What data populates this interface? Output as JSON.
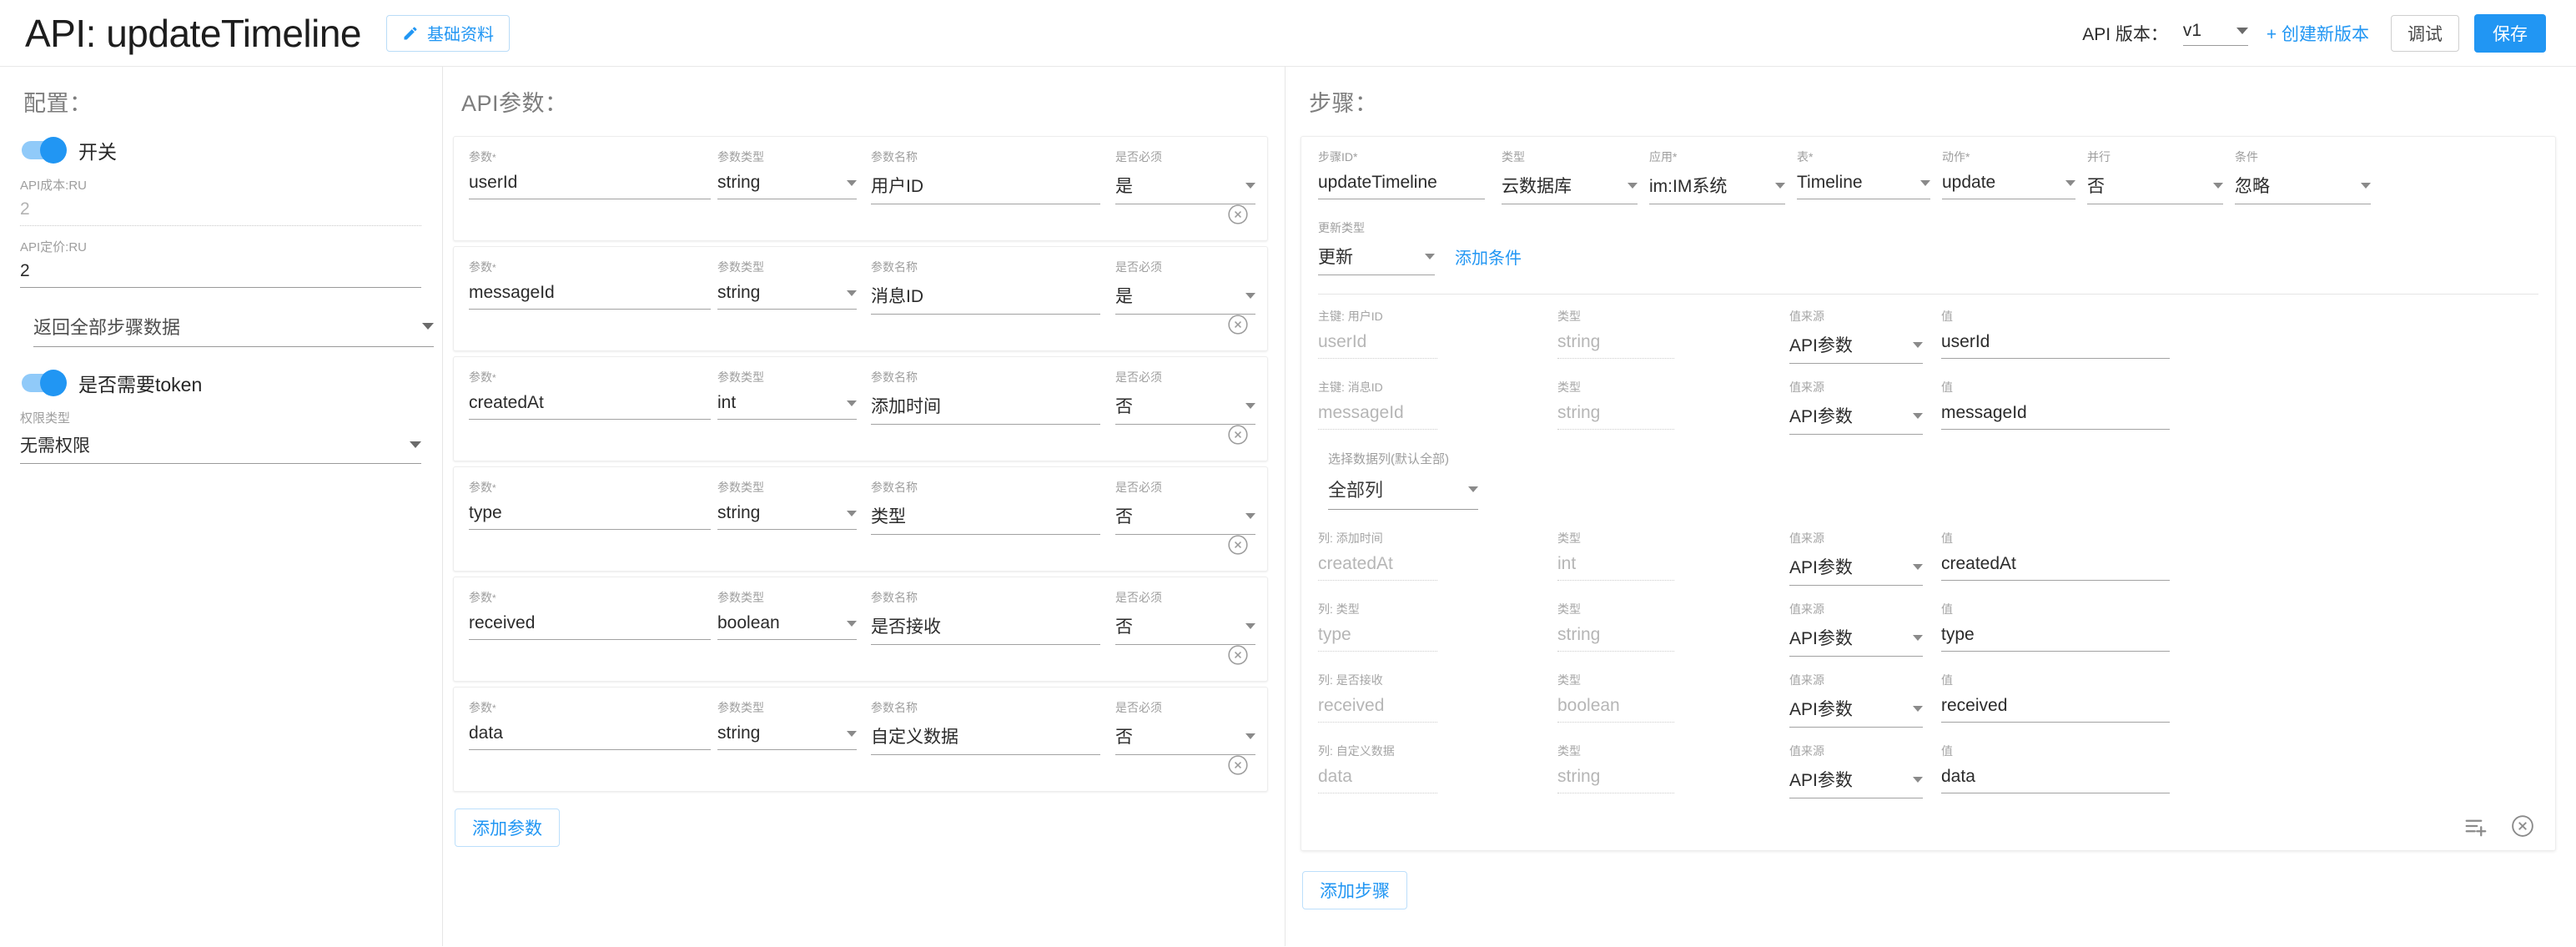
{
  "header": {
    "title": "API: updateTimeline",
    "basic_info_label": "基础资料",
    "pencil_icon": "pencil-icon",
    "version_label": "API 版本：",
    "version_value": "v1",
    "create_version_label": "+ 创建新版本",
    "debug_label": "调试",
    "save_label": "保存",
    "accent": "#2196f3"
  },
  "config": {
    "title": "配置：",
    "switch_label": "开关",
    "switch_on": true,
    "cost_label": "API成本:RU",
    "cost_value": "2",
    "price_label": "API定价:RU",
    "price_value": "2",
    "return_mode": "返回全部步骤数据",
    "token_label": "是否需要token",
    "token_on": true,
    "auth_label": "权限类型",
    "auth_value": "无需权限"
  },
  "params": {
    "title": "API参数：",
    "labels": {
      "param": "参数",
      "type": "参数类型",
      "name": "参数名称",
      "required": "是否必须",
      "star": "*"
    },
    "add_label": "添加参数",
    "rows": [
      {
        "param": "userId",
        "type": "string",
        "name": "用户ID",
        "required": "是"
      },
      {
        "param": "messageId",
        "type": "string",
        "name": "消息ID",
        "required": "是"
      },
      {
        "param": "createdAt",
        "type": "int",
        "name": "添加时间",
        "required": "否"
      },
      {
        "param": "type",
        "type": "string",
        "name": "类型",
        "required": "否"
      },
      {
        "param": "received",
        "type": "boolean",
        "name": "是否接收",
        "required": "否"
      },
      {
        "param": "data",
        "type": "string",
        "name": "自定义数据",
        "required": "否"
      }
    ]
  },
  "steps": {
    "title": "步骤：",
    "add_label": "添加步骤",
    "head_labels": {
      "step_id": "步骤ID",
      "type": "类型",
      "app": "应用",
      "table": "表",
      "action": "动作",
      "parallel": "并行",
      "condition": "条件",
      "update_type": "更新类型",
      "star": "*"
    },
    "head_values": {
      "step_id": "updateTimeline",
      "type": "云数据库",
      "app": "im:IM系统",
      "table": "Timeline",
      "action": "update",
      "parallel": "否",
      "condition": "忽略",
      "update_type": "更新"
    },
    "add_condition_label": "添加条件",
    "map_labels": {
      "type": "类型",
      "source": "值来源",
      "value": "值"
    },
    "data_col_label": "选择数据列(默认全部)",
    "data_col_value": "全部列",
    "keys": [
      {
        "col_label": "主键: 用户ID",
        "col": "userId",
        "type": "string",
        "source": "API参数",
        "value": "userId"
      },
      {
        "col_label": "主键: 消息ID",
        "col": "messageId",
        "type": "string",
        "source": "API参数",
        "value": "messageId"
      }
    ],
    "columns": [
      {
        "col_label": "列: 添加时间",
        "col": "createdAt",
        "type": "int",
        "source": "API参数",
        "value": "createdAt"
      },
      {
        "col_label": "列: 类型",
        "col": "type",
        "type": "string",
        "source": "API参数",
        "value": "type"
      },
      {
        "col_label": "列: 是否接收",
        "col": "received",
        "type": "boolean",
        "source": "API参数",
        "value": "received"
      },
      {
        "col_label": "列: 自定义数据",
        "col": "data",
        "type": "string",
        "source": "API参数",
        "value": "data"
      }
    ],
    "footer_icons": [
      "add-list-item-icon",
      "delete-step-icon"
    ]
  }
}
